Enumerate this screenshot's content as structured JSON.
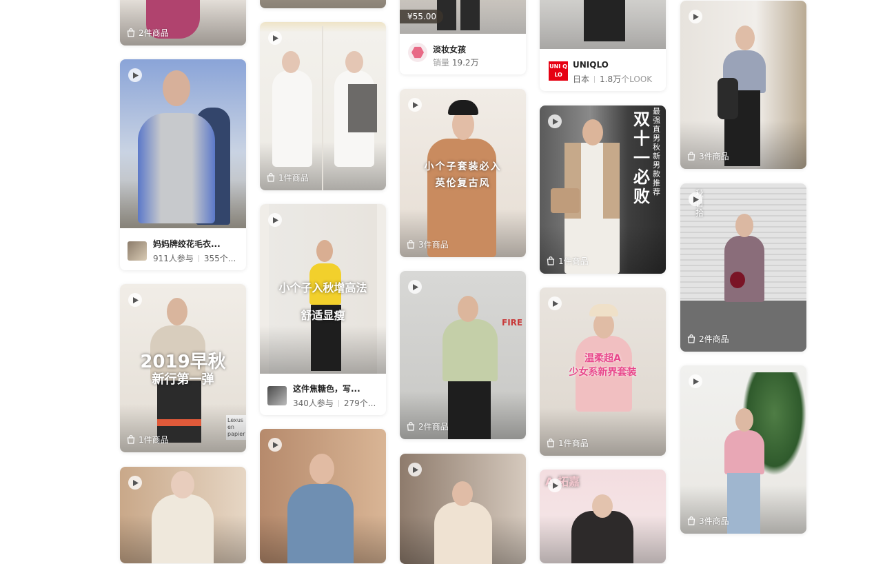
{
  "icons": {
    "play": "play-icon",
    "bag": "shopping-bag-icon"
  },
  "colors": {
    "shop_logo": "#e86a86",
    "uniqlo_red": "#e60012"
  },
  "col1": {
    "c1": {
      "count": "2件商品"
    },
    "c2": {
      "title": "妈妈牌绞花毛衣...",
      "participants": "911人参与",
      "items": "355个..."
    },
    "c3": {
      "count": "1件商品",
      "overlay1": "2019早秋",
      "overlay2": "新行第一弹",
      "sign": "Lexus en papier"
    },
    "c4": {}
  },
  "col2": {
    "c1": {},
    "c2": {
      "count": "1件商品"
    },
    "c3": {
      "overlay1": "小个子入秋增高法",
      "overlay2": "舒适显瘦",
      "title": "这件焦糖色，写...",
      "participants": "340人参与",
      "items": "279个..."
    },
    "c4": {}
  },
  "col3": {
    "c1": {
      "price": "¥55.00",
      "shop_name": "淡妆女孩",
      "sales_label": "销量",
      "sales_value": "19.2万"
    },
    "c2": {
      "count": "3件商品",
      "overlay1": "小个子套装必入",
      "overlay2": "英伦复古风"
    },
    "c3": {
      "count": "2件商品",
      "sign": "FIRE"
    },
    "c4": {}
  },
  "col4": {
    "c1": {
      "brand_name": "UNIQLO",
      "logo_text": "UNI QLO",
      "country": "日本",
      "look_value": "1.8万",
      "look_suffix": "个LOOK"
    },
    "c2": {
      "count": "1件商品",
      "overlay1": "双十一必败",
      "overlay2": "最强直男秋 新男款推荐"
    },
    "c3": {
      "count": "1件商品",
      "overlay1": "温柔超A",
      "overlay2": "少女系新界套装"
    },
    "c4": {
      "overlay1": "A 拓嘉"
    }
  },
  "col5": {
    "c1": {
      "count": "3件商品"
    },
    "c2": {
      "count": "2件商品",
      "overlay1": "秋日拾"
    },
    "c3": {
      "count": "3件商品"
    }
  }
}
